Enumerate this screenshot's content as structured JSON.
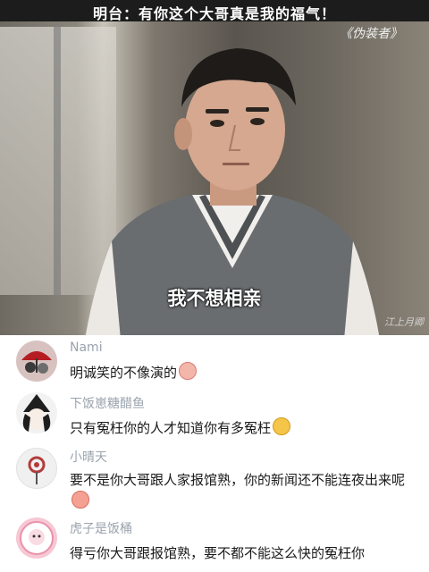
{
  "video": {
    "title": "明台：有你这个大哥真是我的福气！",
    "show_tag": "《伪装者》",
    "subtitle": "我不想相亲",
    "watermark": "江上月卿"
  },
  "comments": [
    {
      "username": "Nami",
      "text": "明诚笑的不像演的",
      "emoji": "crying-face-icon",
      "avatar": "umbrella-avatar"
    },
    {
      "username": "下饭崽糖醋鱼",
      "text": "只有冤枉你的人才知道你有多冤枉",
      "emoji": "mango-face-icon",
      "avatar": "witch-avatar"
    },
    {
      "username": "小晴天",
      "text": "要不是你大哥跟人家报馆熟，你的新闻还不能连夜出来呢",
      "emoji": "peach-face-icon",
      "avatar": "lollipop-avatar"
    },
    {
      "username": "虎子是饭桶",
      "text": "得亏你大哥跟报馆熟，要不都不能这么快的冤枉你",
      "emoji": "",
      "avatar": "pink-sheep-avatar"
    }
  ],
  "colors": {
    "username": "#9aa3ad",
    "text": "#1a1a1a",
    "topbar": "#1c1c1c"
  }
}
